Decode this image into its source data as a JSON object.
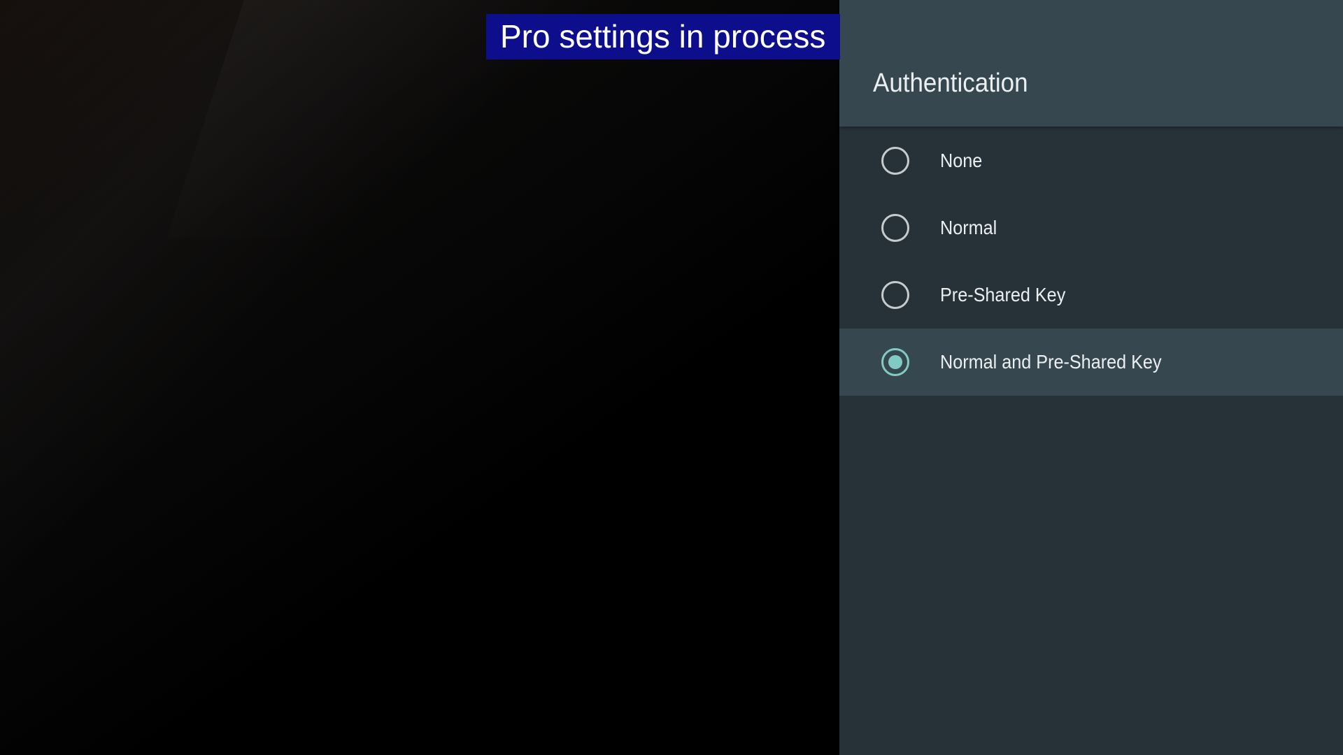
{
  "banner": {
    "text": "Pro settings in process"
  },
  "panel": {
    "title": "Authentication",
    "options": [
      {
        "label": "None",
        "selected": false
      },
      {
        "label": "Normal",
        "selected": false
      },
      {
        "label": "Pre-Shared Key",
        "selected": false
      },
      {
        "label": "Normal and Pre-Shared Key",
        "selected": true
      }
    ]
  },
  "colors": {
    "panel_background": "#263238",
    "header_background": "#37474f",
    "accent": "#80cbc4",
    "banner_background": "#0d0e8c"
  }
}
